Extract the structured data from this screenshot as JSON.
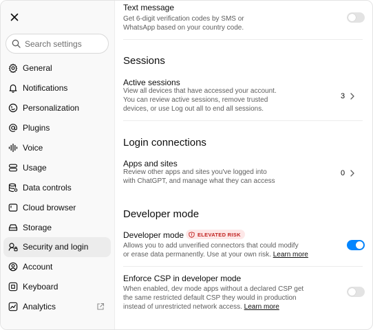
{
  "sidebar": {
    "search_placeholder": "Search settings",
    "items": [
      {
        "label": "General",
        "icon": "gear-icon"
      },
      {
        "label": "Notifications",
        "icon": "bell-icon"
      },
      {
        "label": "Personalization",
        "icon": "personalization-icon"
      },
      {
        "label": "Plugins",
        "icon": "at-icon"
      },
      {
        "label": "Voice",
        "icon": "waveform-icon"
      },
      {
        "label": "Usage",
        "icon": "usage-icon"
      },
      {
        "label": "Data controls",
        "icon": "database-icon"
      },
      {
        "label": "Cloud browser",
        "icon": "browser-icon"
      },
      {
        "label": "Storage",
        "icon": "storage-icon"
      },
      {
        "label": "Security and login",
        "icon": "lock-icon"
      },
      {
        "label": "Account",
        "icon": "account-icon"
      },
      {
        "label": "Keyboard",
        "icon": "keyboard-icon"
      },
      {
        "label": "Analytics",
        "icon": "analytics-icon"
      }
    ],
    "active_item": "Security and login"
  },
  "main": {
    "text_message": {
      "title": "Text message",
      "desc_1": "Get 6-digit verification codes by SMS or",
      "desc_2": "WhatsApp based on your country code.",
      "enabled": false
    },
    "sessions": {
      "heading": "Sessions",
      "title": "Active sessions",
      "desc_1": "View all devices that have accessed your account.",
      "desc_2": "You can review active sessions, remove trusted",
      "desc_3": "devices, or use Log out all to end all sessions.",
      "count": "3"
    },
    "login_connections": {
      "heading": "Login connections",
      "title": "Apps and sites",
      "desc_1": "Review other apps and sites you've logged into",
      "desc_2": "with ChatGPT, and manage what they can access",
      "count": "0"
    },
    "developer_mode": {
      "heading": "Developer mode",
      "title": "Developer mode",
      "badge": "ELEVATED RISK",
      "desc_1": "Allows you to add unverified connectors that could modify",
      "desc_2": "or erase data permanently. Use at your own risk.",
      "learn_more": "Learn more",
      "enabled": true
    },
    "enforce_csp": {
      "title": "Enforce CSP in developer mode",
      "desc_1": "When enabled, dev mode apps without a declared CSP get",
      "desc_2": "the same restricted default CSP they would in production",
      "desc_3": "instead of unrestricted network access.",
      "learn_more": "Learn more",
      "enabled": false
    }
  },
  "colors": {
    "accent": "#0285ff",
    "danger": "#c0201f",
    "danger_bg": "#fde7e7"
  }
}
